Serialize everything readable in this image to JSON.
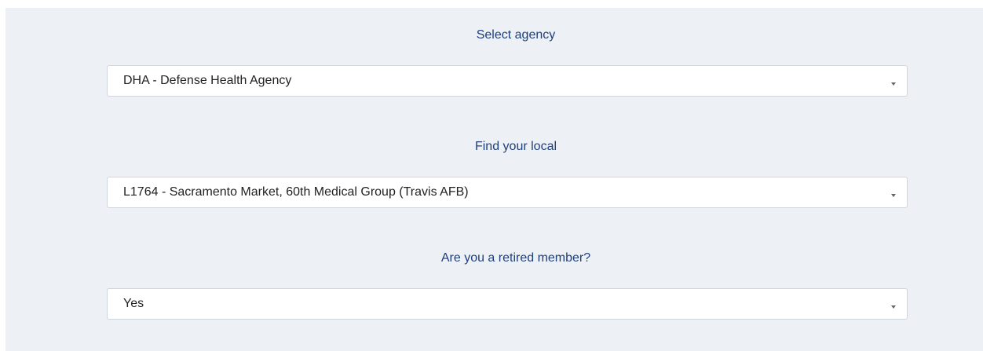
{
  "fields": [
    {
      "label": "Select agency",
      "value": "DHA - Defense Health Agency",
      "icon": "chevron-down-icon"
    },
    {
      "label": "Find your local",
      "value": "L1764 - Sacramento Market, 60th Medical Group (Travis AFB)",
      "icon": "chevron-down-icon"
    },
    {
      "label": "Are you a retired member?",
      "value": "Yes",
      "icon": "chevron-down-icon"
    }
  ],
  "colors": {
    "panel_background": "#edf0f5",
    "label_text": "#1f3f7a",
    "select_border": "#cfd6df",
    "value_text": "#222222"
  }
}
